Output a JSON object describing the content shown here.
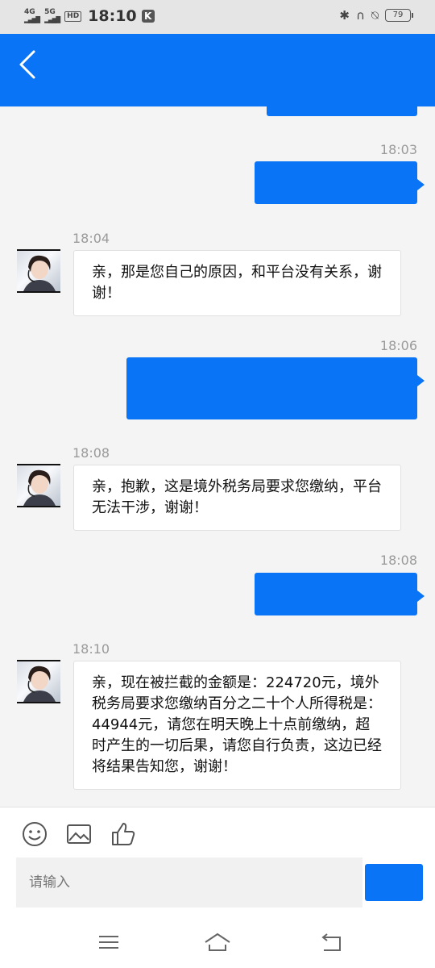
{
  "status_bar": {
    "signal1": "4G",
    "signal2": "5G",
    "hd": "HD",
    "time": "18:10",
    "k": "K",
    "battery": "79"
  },
  "header": {
    "back_icon": "chevron-left-icon"
  },
  "messages": [
    {
      "type": "sent",
      "time": ""
    },
    {
      "type": "sent",
      "time": "18:03"
    },
    {
      "type": "received",
      "time": "18:04",
      "text": "亲，那是您自己的原因，和平台没有关系，谢谢！"
    },
    {
      "type": "sent",
      "time": "18:06"
    },
    {
      "type": "received",
      "time": "18:08",
      "text": "亲，抱歉，这是境外税务局要求您缴纳，平台无法干涉，谢谢！"
    },
    {
      "type": "sent",
      "time": "18:08"
    },
    {
      "type": "received",
      "time": "18:10",
      "text": "亲，现在被拦截的金额是：224720元，境外税务局要求您缴纳百分之二十个人所得税是：44944元，请您在明天晚上十点前缴纳，超时产生的一切后果，请您自行负责，这边已经将结果告知您，谢谢！"
    }
  ],
  "input_bar": {
    "placeholder": "请输入",
    "icons": [
      "emoji-icon",
      "image-icon",
      "thumbs-up-icon"
    ],
    "send_label": ""
  },
  "nav_bar": {
    "icons": [
      "menu-icon",
      "home-icon",
      "back-icon"
    ]
  }
}
